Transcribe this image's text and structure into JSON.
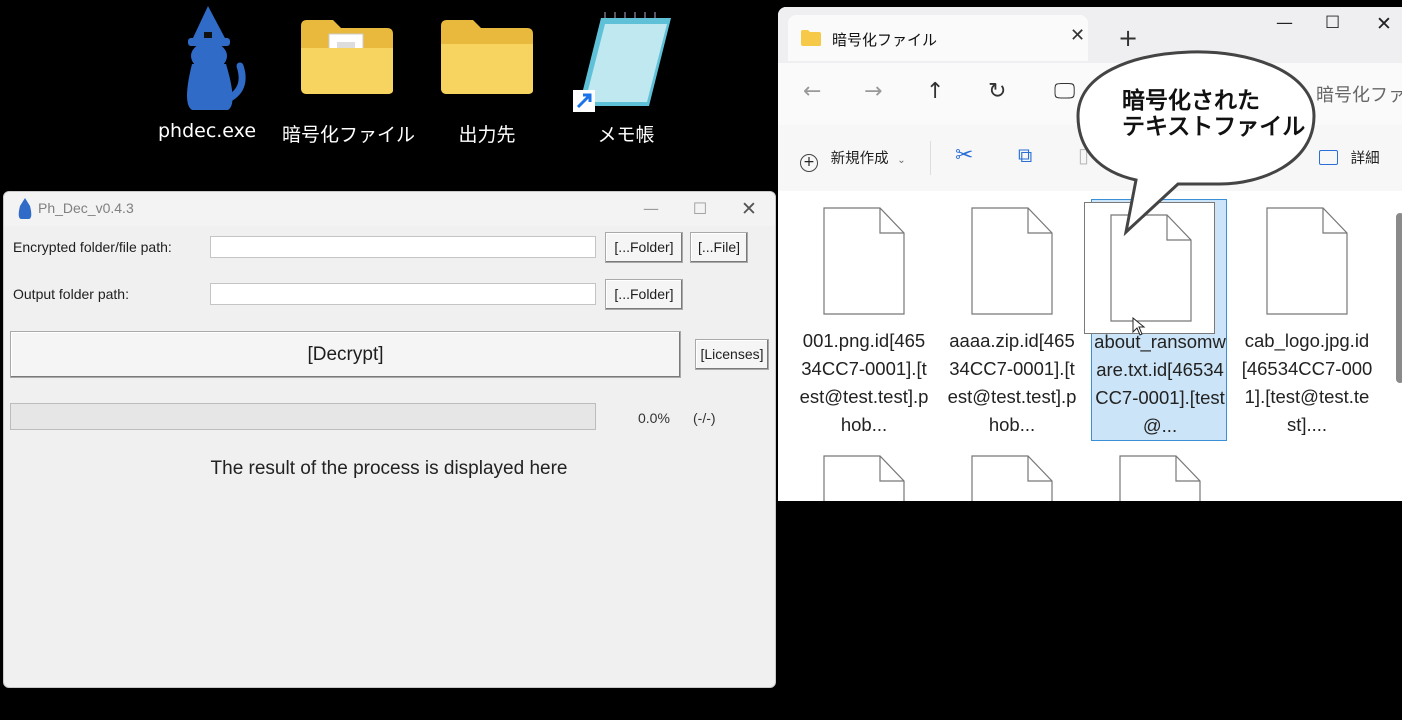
{
  "desktop": {
    "icons": [
      {
        "label": "phdec.exe",
        "icon": "wizard-cat-icon"
      },
      {
        "label": "暗号化ファイル",
        "icon": "folder-with-document-icon"
      },
      {
        "label": "出力先",
        "icon": "folder-icon"
      },
      {
        "label": "メモ帳",
        "icon": "notepad-shortcut-icon"
      }
    ]
  },
  "phdec": {
    "title": "Ph_Dec_v0.4.3",
    "encrypted_label": "Encrypted folder/file path:",
    "encrypted_value": "",
    "output_label": "Output folder path:",
    "output_value": "",
    "folder_button": "[...Folder]",
    "file_button": "[...File]",
    "output_folder_button": "[...Folder]",
    "decrypt_button": "[Decrypt]",
    "licenses_button": "[Licenses]",
    "progress": 0.0,
    "progress_text": "0.0%",
    "count_text": "(-/-)",
    "result_text": "The result of the process is displayed here"
  },
  "explorer": {
    "tab_title": "暗号化ファイル",
    "breadcrumb": "暗号化ファイ",
    "new_button": "新規作成",
    "details_button": "詳細",
    "files": [
      {
        "name": "001.png.id[46534CC7-0001].[test@test.test].phob...",
        "selected": false
      },
      {
        "name": "aaaa.zip.id[46534CC7-0001].[test@test.test].phob...",
        "selected": false
      },
      {
        "name": "about_ransomware.txt.id[46534CC7-0001].[test@...",
        "selected": true
      },
      {
        "name": "cab_logo.jpg.id[46534CC7-0001].[test@test.test]....",
        "selected": false
      }
    ]
  },
  "callout": {
    "text": "暗号化された\nテキストファイル"
  },
  "colors": {
    "selection_fill": "#cce4f7",
    "selection_border": "#3a8fd6",
    "wizard_blue": "#2f6bc7"
  }
}
